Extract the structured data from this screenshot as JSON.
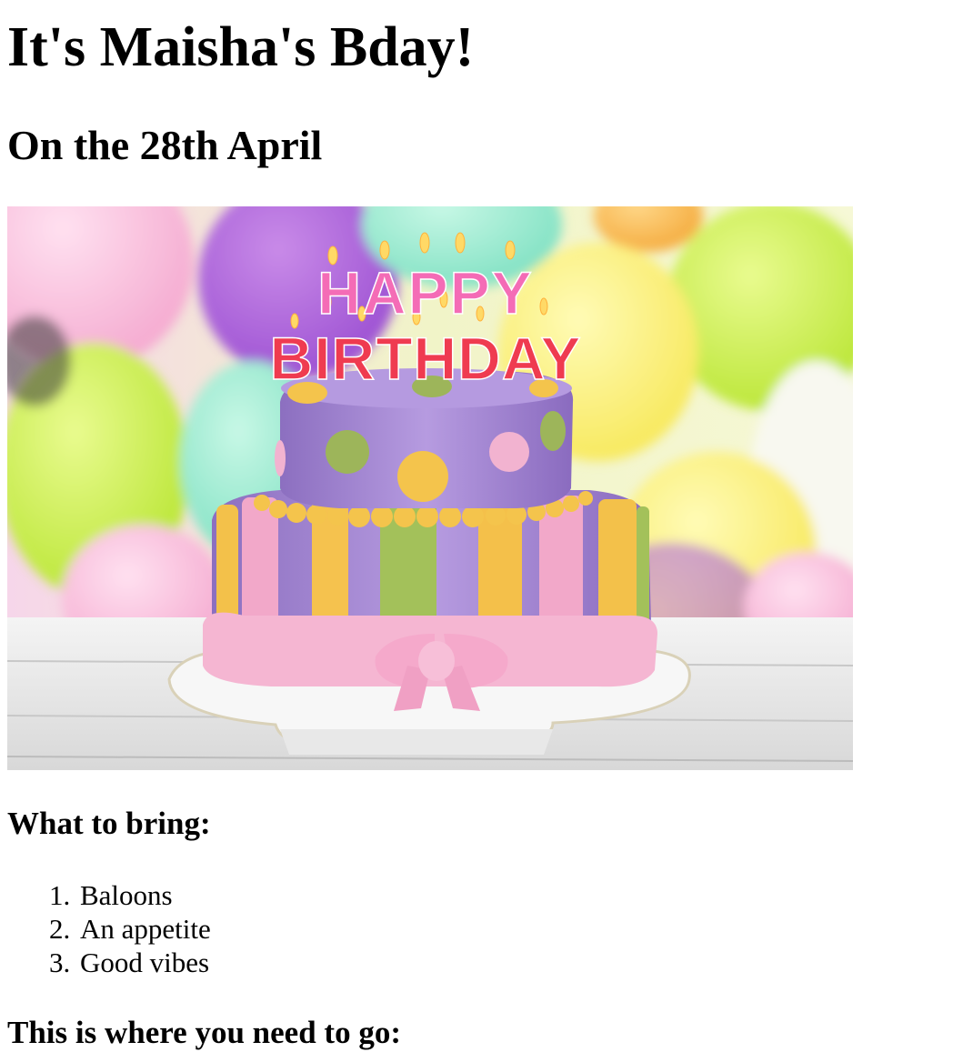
{
  "page": {
    "title": "It's Maisha's Bday!",
    "subtitle": "On the 28th April",
    "hero_image": {
      "description_icon": "birthday-cake-image",
      "candle_text_top": "HAPPY",
      "candle_text_bottom": "BIRTHDAY"
    },
    "bring_heading": "What to bring:",
    "bring_items": [
      {
        "number": "1.",
        "label": "Baloons"
      },
      {
        "number": "2.",
        "label": "An appetite"
      },
      {
        "number": "3.",
        "label": "Good vibes"
      }
    ],
    "directions_heading": "This is where you need to go:"
  }
}
